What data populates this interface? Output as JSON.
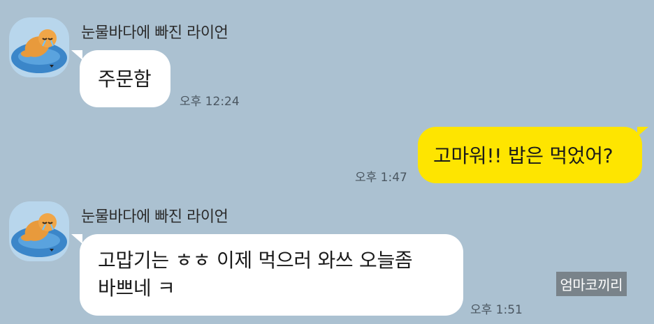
{
  "messages": [
    {
      "sender": "눈물바다에 빠진 라이언",
      "text": "주문함",
      "time": "오후 12:24",
      "direction": "incoming"
    },
    {
      "text": "고마워!! 밥은 먹었어?",
      "time": "오후 1:47",
      "direction": "outgoing"
    },
    {
      "sender": "눈물바다에 빠진 라이언",
      "text_line1": "고맙기는 ㅎㅎ  이제 먹으러 와쓰  오늘좀",
      "text_line2": "바쁘네 ㅋ",
      "time": "오후 1:51",
      "direction": "incoming"
    }
  ],
  "watermark": "엄마코끼리",
  "colors": {
    "background": "#abc1d1",
    "outgoing_bubble": "#fee500",
    "incoming_bubble": "#ffffff"
  },
  "icons": {
    "avatar": "crying-lion-in-water-icon"
  }
}
